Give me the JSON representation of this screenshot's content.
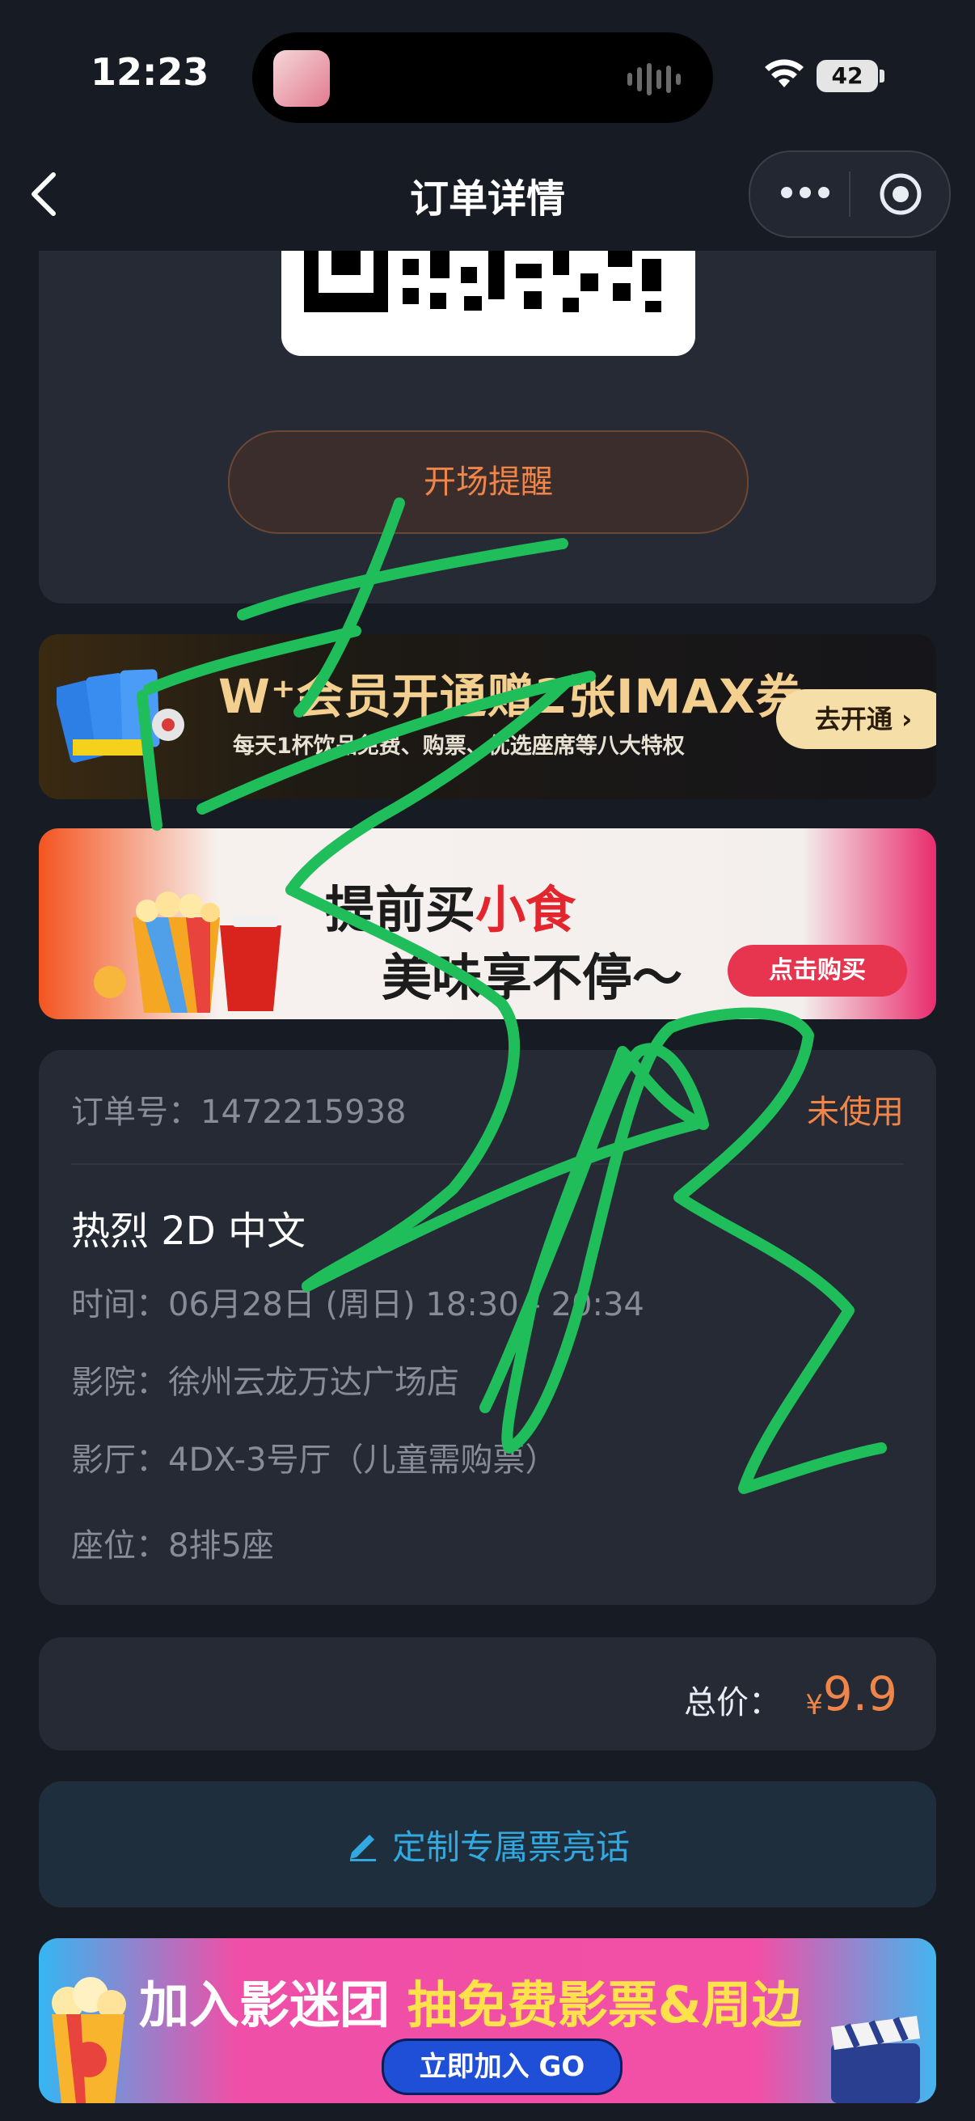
{
  "status_bar": {
    "time": "12:23",
    "battery": "42"
  },
  "nav": {
    "title": "订单详情"
  },
  "ticket": {
    "remind_button": "开场提醒"
  },
  "banners": {
    "vip": {
      "title": "W⁺会员开通赠2张IMAX券",
      "subtitle": "每天1杯饮品免费、购票、优选座席等八大特权",
      "button": "去开通 ›"
    },
    "snack": {
      "line1_prefix": "提前买",
      "line1_highlight": "小食",
      "line2": "美味享不停～",
      "button": "点击购买"
    },
    "fan": {
      "line1_part1": "加入影迷团",
      "line1_part2": "抽免费影票&周边",
      "button": "立即加入 GO"
    }
  },
  "order": {
    "number_label": "订单号：",
    "number": "1472215938",
    "status": "未使用",
    "movie": "热烈 2D 中文",
    "rows": [
      {
        "label": "时间：",
        "value": "06月28日 (周日) 18:30 - 20:34"
      },
      {
        "label": "影院：",
        "value": "徐州云龙万达广场店"
      },
      {
        "label": "影厅：",
        "value": "4DX-3号厅（儿童需购票）"
      },
      {
        "label": "座位：",
        "value": "8排5座"
      }
    ]
  },
  "price": {
    "label": "总价：",
    "currency": "¥",
    "amount": "9.9"
  },
  "custom": {
    "label": "定制专属票亮话"
  },
  "colors": {
    "accent_orange": "#f0854a",
    "link_blue": "#32a8e0",
    "scribble_green": "#1fbe5a",
    "background": "#171b24"
  },
  "icons": [
    "wifi-icon",
    "back-chevron-icon",
    "more-icon",
    "target-icon",
    "edit-pen-icon"
  ]
}
